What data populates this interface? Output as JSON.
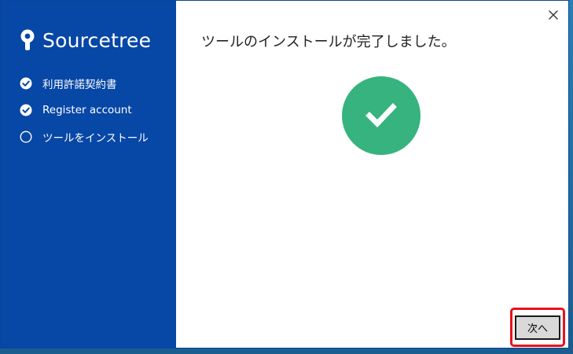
{
  "app": {
    "brand_name": "Sourcetree"
  },
  "sidebar": {
    "steps": [
      {
        "label": "利用許諾契約書",
        "state": "completed",
        "icon": "check-circle-icon"
      },
      {
        "label": "Register account",
        "state": "completed",
        "icon": "check-circle-icon"
      },
      {
        "label": "ツールをインストール",
        "state": "current",
        "icon": "empty-circle-icon"
      }
    ]
  },
  "main": {
    "title": "ツールのインストールが完了しました。",
    "status_icon": "success-check-icon",
    "next_button_label": "次へ",
    "close_icon": "close-icon"
  },
  "colors": {
    "sidebar_bg": "#0747a6",
    "success": "#36b37e",
    "highlight": "#e8121b"
  }
}
